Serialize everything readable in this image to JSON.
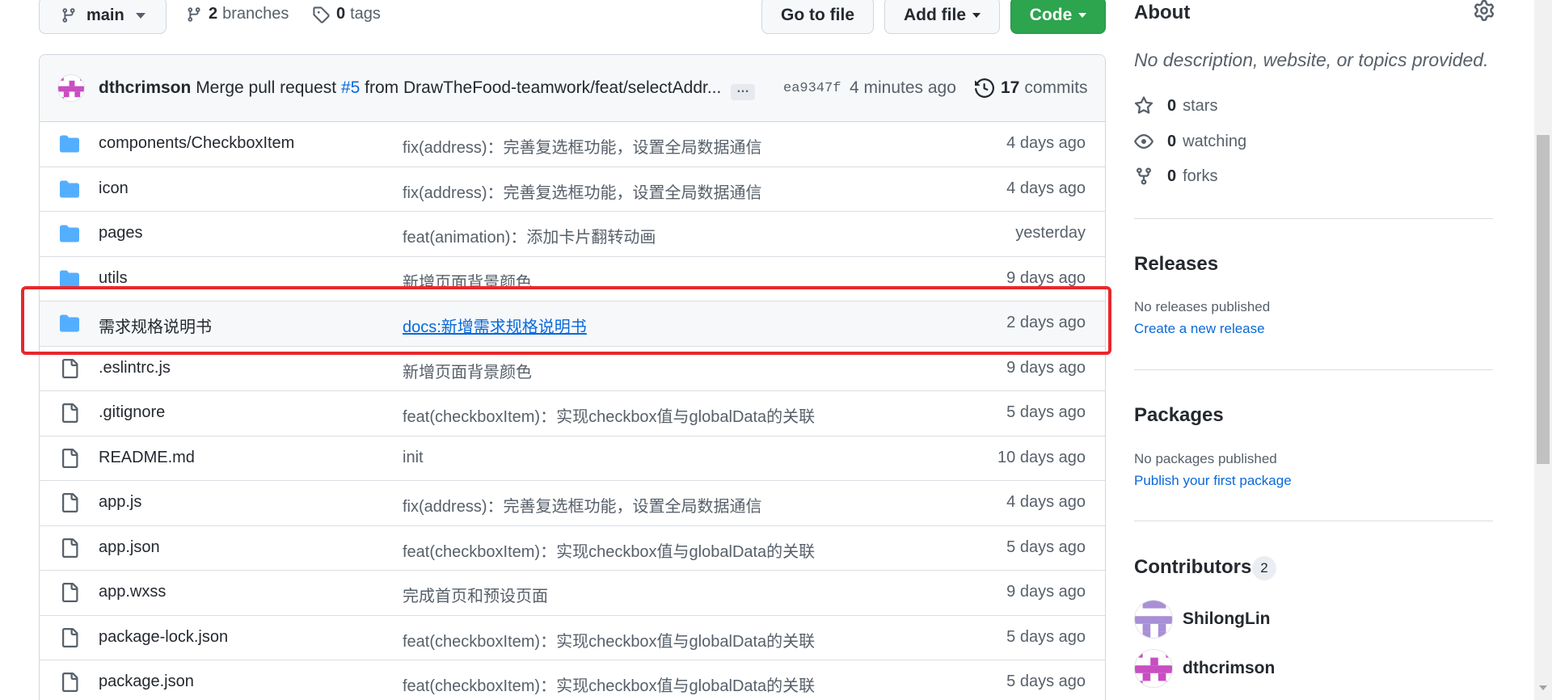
{
  "toolbar": {
    "branch": "main",
    "branches_count": "2",
    "branches_label": "branches",
    "tags_count": "0",
    "tags_label": "tags",
    "go_to_file": "Go to file",
    "add_file": "Add file",
    "code": "Code"
  },
  "commit": {
    "author": "dthcrimson",
    "message_pre": "Merge pull request",
    "pr": "#5",
    "message_post": "from DrawTheFood-teamwork/feat/selectAddr...",
    "ellipsis": "…",
    "sha": "ea9347f",
    "time": "4 minutes ago",
    "commits_count": "17",
    "commits_label": "commits"
  },
  "files": [
    {
      "type": "dir",
      "name": "components/CheckboxItem",
      "message": "fix(address)：完善复选框功能，设置全局数据通信",
      "age": "4 days ago"
    },
    {
      "type": "dir",
      "name": "icon",
      "message": "fix(address)：完善复选框功能，设置全局数据通信",
      "age": "4 days ago"
    },
    {
      "type": "dir",
      "name": "pages",
      "message": "feat(animation)：添加卡片翻转动画",
      "age": "yesterday"
    },
    {
      "type": "dir",
      "name": "utils",
      "message": "新增页面背景颜色",
      "age": "9 days ago"
    },
    {
      "type": "dir",
      "name": "需求规格说明书",
      "message": "docs:新增需求规格说明书",
      "age": "2 days ago"
    },
    {
      "type": "file",
      "name": ".eslintrc.js",
      "message": "新增页面背景颜色",
      "age": "9 days ago"
    },
    {
      "type": "file",
      "name": ".gitignore",
      "message": "feat(checkboxItem)：实现checkbox值与globalData的关联",
      "age": "5 days ago"
    },
    {
      "type": "file",
      "name": "README.md",
      "message": "init",
      "age": "10 days ago"
    },
    {
      "type": "file",
      "name": "app.js",
      "message": "fix(address)：完善复选框功能，设置全局数据通信",
      "age": "4 days ago"
    },
    {
      "type": "file",
      "name": "app.json",
      "message": "feat(checkboxItem)：实现checkbox值与globalData的关联",
      "age": "5 days ago"
    },
    {
      "type": "file",
      "name": "app.wxss",
      "message": "完成首页和预设页面",
      "age": "9 days ago"
    },
    {
      "type": "file",
      "name": "package-lock.json",
      "message": "feat(checkboxItem)：实现checkbox值与globalData的关联",
      "age": "5 days ago"
    },
    {
      "type": "file",
      "name": "package.json",
      "message": "feat(checkboxItem)：实现checkbox值与globalData的关联",
      "age": "5 days ago"
    }
  ],
  "sidebar": {
    "about_title": "About",
    "about_desc": "No description, website, or topics provided.",
    "stars_count": "0",
    "stars_label": "stars",
    "watching_count": "0",
    "watching_label": "watching",
    "forks_count": "0",
    "forks_label": "forks",
    "releases_title": "Releases",
    "releases_none": "No releases published",
    "releases_link": "Create a new release",
    "packages_title": "Packages",
    "packages_none": "No packages published",
    "packages_link": "Publish your first package",
    "contributors_title": "Contributors",
    "contributors_count": "2",
    "contributors": [
      "ShilongLin",
      "dthcrimson"
    ]
  },
  "colors": {
    "accent": "#0969da",
    "code_button": "#2da44e",
    "folder": "#54aeff",
    "highlight_box": "#e8272b"
  }
}
